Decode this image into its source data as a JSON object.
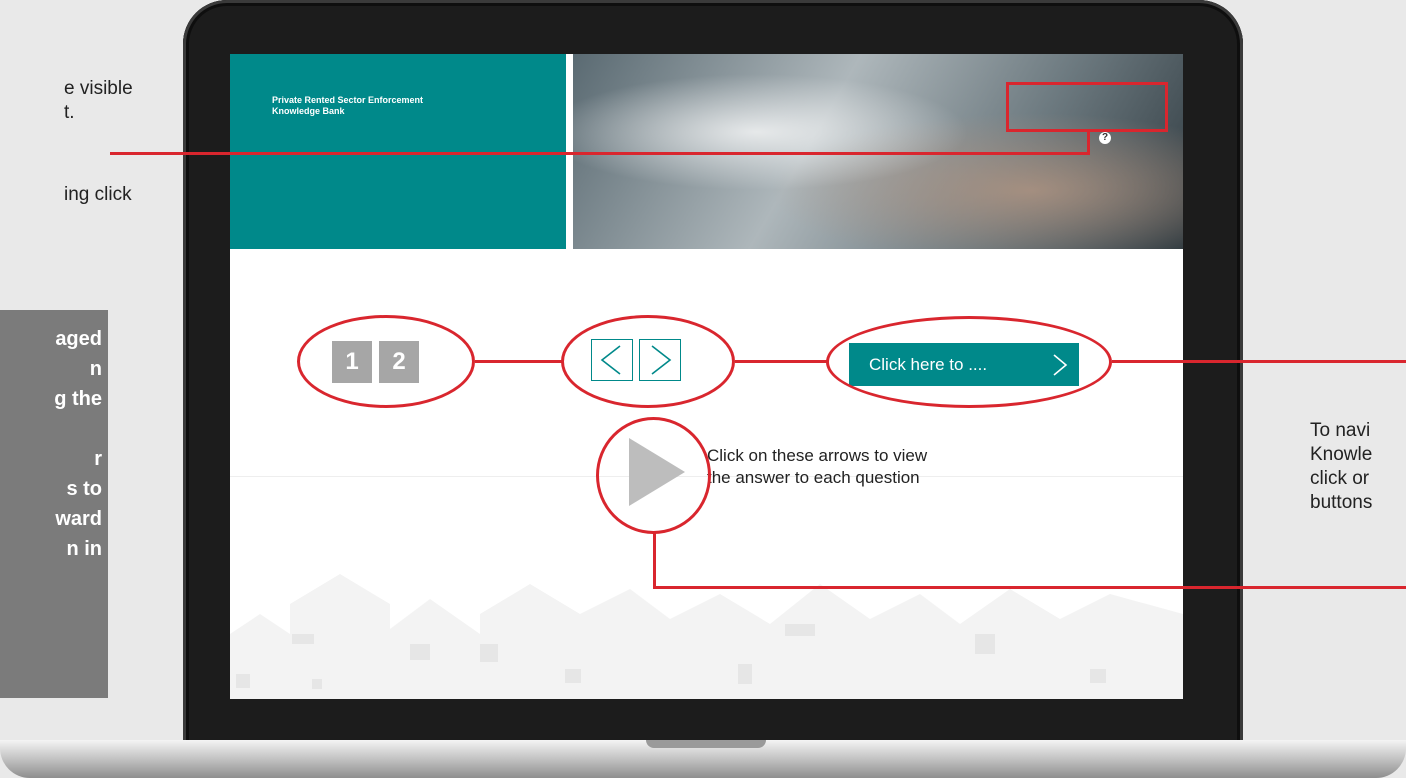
{
  "left_annotation": {
    "lines": [
      "e visible",
      "t.",
      "ing click"
    ]
  },
  "grey_annotation": {
    "lines": [
      "aged",
      "n",
      "g the",
      "r",
      "s to",
      "ward",
      "n in"
    ]
  },
  "right_annotation": {
    "lines": [
      "To navi",
      "Knowle",
      "click or",
      "buttons"
    ]
  },
  "app": {
    "title_line1": "Private Rented Sector Enforcement",
    "title_line2": "Knowledge Bank",
    "help_icon": "?",
    "page_buttons": [
      "1",
      "2"
    ],
    "cta_label": "Click here to ....",
    "play_note_line1": "Click on these arrows to view",
    "play_note_line2": "the answer to each question"
  },
  "colors": {
    "teal": "#00898a",
    "red_annotation": "#d9262e",
    "tile_grey": "#a6a6a6"
  }
}
